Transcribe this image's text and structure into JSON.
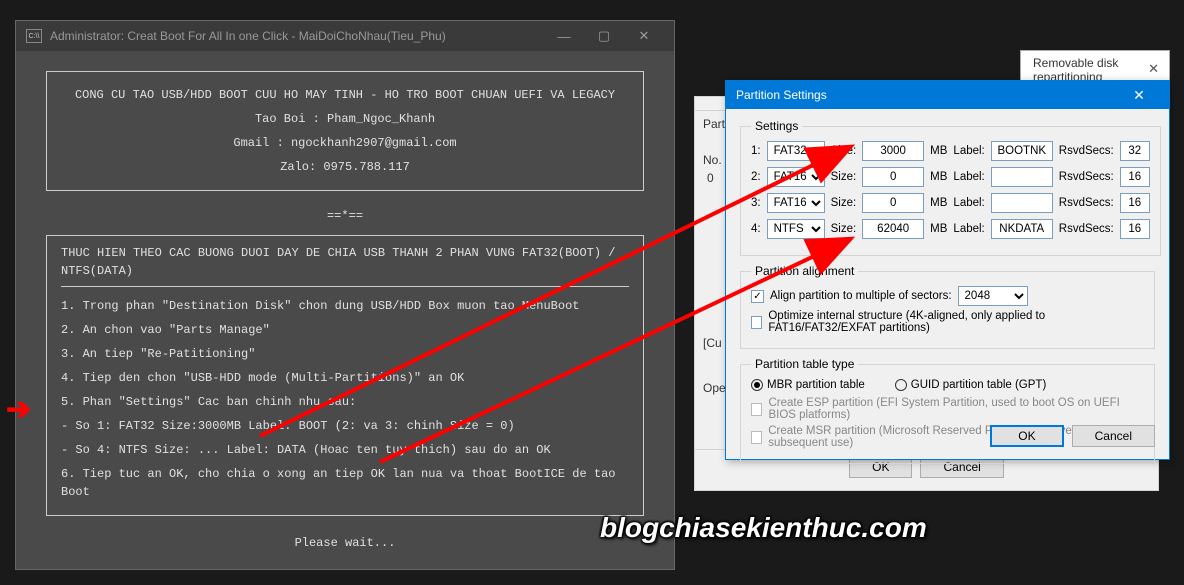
{
  "cmd": {
    "title": "Administrator:  Creat Boot For All  In one Click - MaiDoiChoNhau(Tieu_Phu)",
    "header": {
      "line1": "CONG CU TAO USB/HDD BOOT CUU HO MAY TINH - HO TRO BOOT CHUAN UEFI VA LEGACY",
      "line2": "Tao Boi : Pham_Ngoc_Khanh",
      "line3": "Gmail : ngockhanh2907@gmail.com",
      "line4": "Zalo: 0975.788.117"
    },
    "sep": "==*==",
    "instr_title": "THUC HIEN THEO CAC BUONG DUOI DAY DE CHIA USB THANH 2 PHAN VUNG FAT32(BOOT) / NTFS(DATA)",
    "steps": [
      "1. Trong phan  \"Destination Disk\"  chon dung USB/HDD Box muon tao MenuBoot",
      "2. An chon vao \"Parts Manage\"",
      "3. An tiep \"Re-Patitioning\"",
      "4. Tiep den chon \"USB-HDD mode (Multi-Partitions)\" an OK",
      "5. Phan \"Settings\" Cac ban chinh nhu sau:",
      "- So 1: FAT32   Size:3000MB   Label: BOOT  (2: va 3: chinh Size = 0)",
      "- So 4: NTFS   Size: ...    Label: DATA  (Hoac ten tuy thich) sau do an OK",
      "6. Tiep tuc an OK, cho chia o xong an tiep OK lan nua va thoat BootICE de tao Boot"
    ],
    "wait": "Please wait..."
  },
  "bg1": {
    "title": "Removable disk repartitioning"
  },
  "bg2": {
    "ok": "OK",
    "cancel": "Cancel"
  },
  "bgLeft": {
    "l1": "Partitio",
    "l2": "No.",
    "l3": "0",
    "l4": "[Cu",
    "l5": "Ope"
  },
  "dialog": {
    "title": "Partition Settings",
    "legend_settings": "Settings",
    "rows": [
      {
        "idx": "1:",
        "fs": "FAT32",
        "size": "3000",
        "label": "BOOTNK",
        "rsvd": "32"
      },
      {
        "idx": "2:",
        "fs": "FAT16",
        "size": "0",
        "label": "",
        "rsvd": "16"
      },
      {
        "idx": "3:",
        "fs": "FAT16",
        "size": "0",
        "label": "",
        "rsvd": "16"
      },
      {
        "idx": "4:",
        "fs": "NTFS",
        "size": "62040",
        "label": "NKDATA",
        "rsvd": "16"
      }
    ],
    "lbl_size": "Size:",
    "lbl_mb": "MB",
    "lbl_label": "Label:",
    "lbl_rsvd": "RsvdSecs:",
    "legend_align": "Partition alignment",
    "align_check": "Align partition to multiple of sectors:",
    "align_val": "2048",
    "opt_check": "Optimize internal structure (4K-aligned, only applied to FAT16/FAT32/EXFAT partitions)",
    "legend_type": "Partition table type",
    "radio_mbr": "MBR partition table",
    "radio_gpt": "GUID partition table (GPT)",
    "esp": "Create ESP partition (EFI System Partition, used to boot OS on UEFI BIOS platforms)",
    "msr": "Create MSR partition (Microsoft Reserved Partition, reserved space for subsequent use)",
    "ok": "OK",
    "cancel": "Cancel"
  },
  "watermark": "blogchiasekienthuc.com"
}
